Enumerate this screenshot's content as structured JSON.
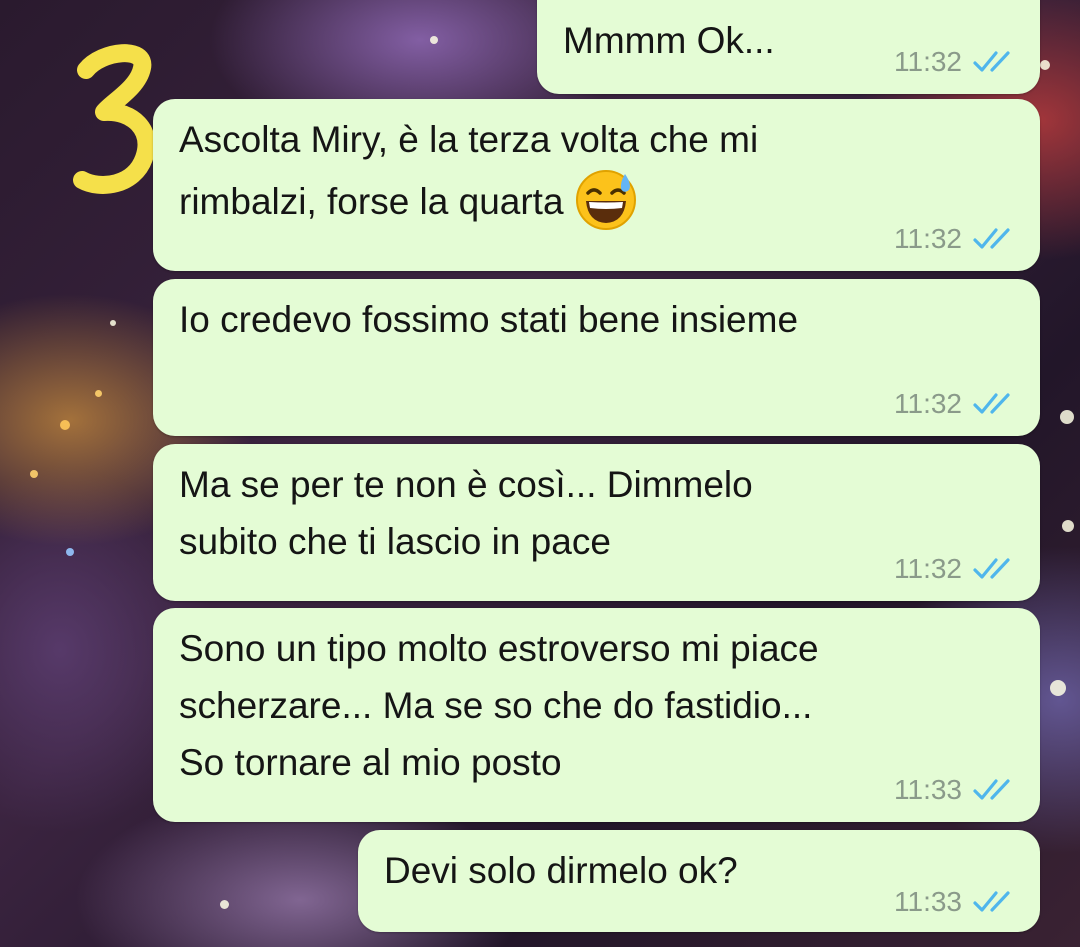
{
  "annotation": {
    "number": "3",
    "color": "#f5e04a"
  },
  "colors": {
    "bubble": "#e4fcd5",
    "tick": "#4fb6ec",
    "time": "#8a9a8a"
  },
  "messages": [
    {
      "text": "Mmmm Ok...",
      "time": "11:32",
      "status": "read-double-tick-icon"
    },
    {
      "text": "Ascolta Miry, è la terza volta che mi\nrimbalzi, forse la quarta",
      "emoji": "grinning-face-with-sweat-emoji",
      "time": "11:32",
      "status": "read-double-tick-icon"
    },
    {
      "text": "Io credevo fossimo stati bene insieme",
      "time": "11:32",
      "status": "read-double-tick-icon"
    },
    {
      "text": "Ma se per te non è così... Dimmelo\nsubito che ti lascio in pace",
      "time": "11:32",
      "status": "read-double-tick-icon"
    },
    {
      "text": "Sono un tipo molto estroverso mi piace\nscherzare... Ma se so che do fastidio...\nSo tornare al mio posto",
      "time": "11:33",
      "status": "read-double-tick-icon"
    },
    {
      "text": "Devi solo dirmelo ok?",
      "time": "11:33",
      "status": "read-double-tick-icon"
    }
  ]
}
